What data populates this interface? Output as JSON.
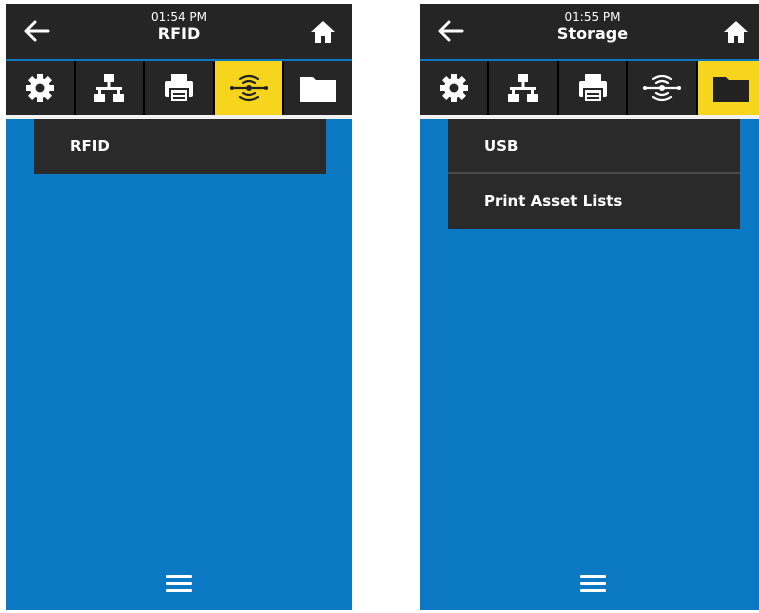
{
  "screens": [
    {
      "time": "01:54 PM",
      "title": "RFID",
      "active_tab": 3,
      "menu_items": [
        "RFID"
      ]
    },
    {
      "time": "01:55 PM",
      "title": "Storage",
      "active_tab": 4,
      "menu_items": [
        "USB",
        "Print Asset Lists"
      ]
    }
  ],
  "tabs": [
    "settings-icon",
    "network-icon",
    "printer-icon",
    "rfid-icon",
    "storage-folder-icon"
  ],
  "colors": {
    "background": "#0a78c2",
    "header": "#252525",
    "tab_active": "#f6d51c",
    "menu": "#2a2a2a"
  }
}
